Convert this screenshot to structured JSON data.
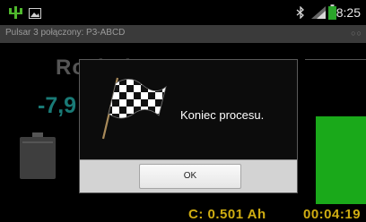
{
  "statusbar": {
    "time": "8:25",
    "icons": [
      "usb-icon",
      "gallery-icon",
      "bluetooth-icon",
      "signal-icon",
      "battery-icon"
    ]
  },
  "titlebar": {
    "title": "Pulsar 3 połączony: P3-ABCD"
  },
  "background": {
    "mode_label": "Rozład",
    "current_value": "-7,9",
    "capacity": "C: 0.501 Ah",
    "elapsed_time": "00:04:19",
    "colors": {
      "accent_teal": "#197a76",
      "progress_green": "#1aa91a",
      "amber": "#d0ad12"
    }
  },
  "dialog": {
    "icon": "checkered-flag-icon",
    "message": "Koniec procesu.",
    "ok_label": "OK"
  }
}
